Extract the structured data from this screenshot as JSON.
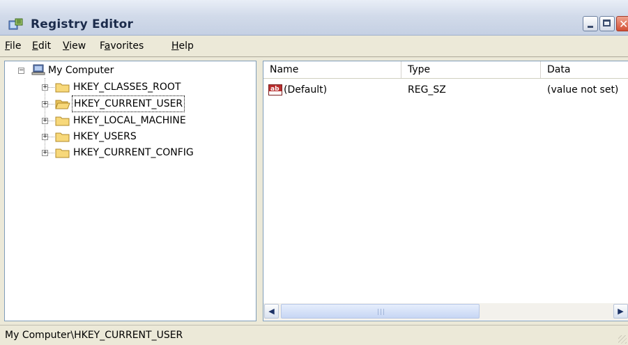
{
  "window": {
    "title": "Registry Editor",
    "controls": {
      "minimize": "minimize",
      "maximize": "maximize",
      "close": "close"
    }
  },
  "menu": {
    "items": [
      {
        "label": "File",
        "underline": "F",
        "rest": "ile"
      },
      {
        "label": "Edit",
        "underline": "E",
        "rest": "dit"
      },
      {
        "label": "View",
        "underline": "V",
        "rest": "iew"
      },
      {
        "label": "Favorites",
        "pre": "F",
        "underline": "a",
        "rest": "vorites"
      },
      {
        "label": "Help",
        "underline": "H",
        "rest": "elp"
      }
    ]
  },
  "tree": {
    "root": {
      "label": "My Computer",
      "icon": "computer-icon",
      "expanded": true
    },
    "children": [
      {
        "label": "HKEY_CLASSES_ROOT",
        "icon": "folder-icon",
        "selected": false
      },
      {
        "label": "HKEY_CURRENT_USER",
        "icon": "folder-open-icon",
        "selected": true
      },
      {
        "label": "HKEY_LOCAL_MACHINE",
        "icon": "folder-icon",
        "selected": false
      },
      {
        "label": "HKEY_USERS",
        "icon": "folder-icon",
        "selected": false
      },
      {
        "label": "HKEY_CURRENT_CONFIG",
        "icon": "folder-icon",
        "selected": false
      }
    ]
  },
  "list": {
    "columns": [
      "Name",
      "Type",
      "Data"
    ],
    "rows": [
      {
        "name": "(Default)",
        "type": "REG_SZ",
        "data": "(value not set)",
        "icon": "string-value-icon"
      }
    ]
  },
  "statusbar": {
    "path": "My Computer\\HKEY_CURRENT_USER"
  },
  "colors": {
    "title_gradient_top": "#e9eef7",
    "close_button": "#d24f34",
    "chrome": "#ece9d8",
    "pane_border": "#7f9db9"
  }
}
